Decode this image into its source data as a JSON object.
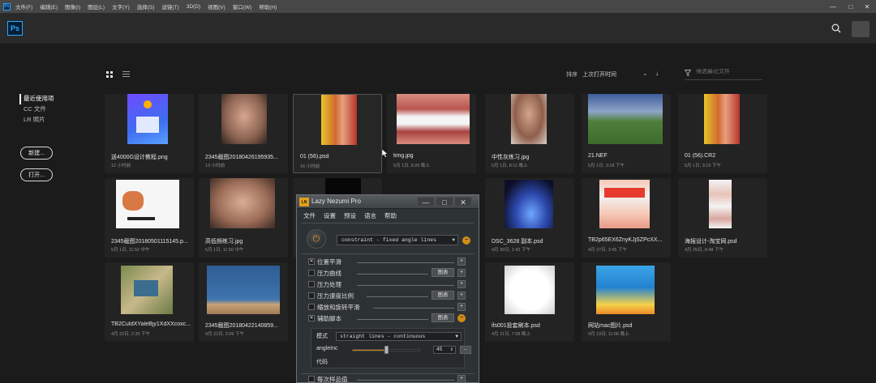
{
  "menubar": {
    "items": [
      "文件(F)",
      "编辑(E)",
      "图像(I)",
      "图层(L)",
      "文字(Y)",
      "选择(S)",
      "滤镜(T)",
      "3D(D)",
      "视图(V)",
      "窗口(W)",
      "帮助(H)"
    ],
    "minimize": "—",
    "maximize": "□",
    "close": "✕"
  },
  "app": {
    "logo": "Ps"
  },
  "leftnav": {
    "items": [
      "最近使用项",
      "CC 文件",
      "LR 照片"
    ],
    "new_button": "新建...",
    "open_button": "打开..."
  },
  "toolbar": {
    "sort_label": "排序",
    "sort_value": "上次打开时间",
    "sort_arrow": "↓",
    "filter_placeholder": "筛选最近文件"
  },
  "files": [
    {
      "name": "送4000G设计教程.png",
      "date": "12 小时前"
    },
    {
      "name": "2345截图20180426195935...",
      "date": "13 小时前"
    },
    {
      "name": "01 (56).psd",
      "date": "16 小时前"
    },
    {
      "name": "timg.jpg",
      "date": "5月 1日, 8:26 晚上"
    },
    {
      "name": "中性灰练习.jpg",
      "date": "5月 1日, 8:11 晚上"
    },
    {
      "name": "21.NEF",
      "date": "5月 1日, 3:18 下午"
    },
    {
      "name": "01 (56).CR2",
      "date": "5月 1日, 3:15 下午"
    },
    {
      "name": "2345截图20180501115145.p...",
      "date": "5月 1日, 11:52 中午"
    },
    {
      "name": "高低频练习.jpg",
      "date": "5月 1日, 11:50 中午"
    },
    {
      "name": "DSC_3628 副本.psd",
      "date": "4月 30日, 1:42 下午"
    },
    {
      "name": "TB2p65EX6ZnyKJjSZPcXX...",
      "date": "4月 27日, 3:45 下午"
    },
    {
      "name": "海报设计-淘宝网.psd",
      "date": "4月 25日, 8:48 下午"
    },
    {
      "name": "TB2CuIdXYaIeBjy1XdXXcoxc...",
      "date": "4月 22日, 2:39 下午"
    },
    {
      "name": "2345截图20180422140859...",
      "date": "4月 22日, 2:09 下午"
    },
    {
      "name": "ifs001投套刷本.psd",
      "date": "4月 21日, 7:58 晚上"
    },
    {
      "name": "网站mac图片.psd",
      "date": "4月 19日, 11:06 晚上"
    }
  ],
  "plugin": {
    "logo": "LN",
    "title": "Lazy Nezumi Pro",
    "ctl_min": "—",
    "ctl_max": "□",
    "ctl_close": "✕",
    "menu": [
      "文件",
      "设置",
      "预设",
      "语言",
      "帮助"
    ],
    "power_glyph": "⏻",
    "mode": "constraint - fixed angle lines",
    "options": [
      {
        "label": "位置平滑",
        "checked": "✕",
        "btn": "",
        "sq": "+"
      },
      {
        "label": "压力曲线",
        "checked": "",
        "btn": "图表",
        "sq": "+"
      },
      {
        "label": "压力处理",
        "checked": "",
        "btn": "",
        "sq": "+"
      },
      {
        "label": "压力速度比例",
        "checked": "",
        "btn": "图表",
        "sq": "+"
      },
      {
        "label": "缩放和旋转平滑",
        "checked": "",
        "btn": "",
        "sq": "+"
      },
      {
        "label": "辅助脚本",
        "checked": "✕",
        "btn": "图表",
        "sq": "−"
      }
    ],
    "sub": {
      "mode_label": "模式",
      "mode_value": "straight lines - continuous",
      "angle_label": "angleInc",
      "angle_value": "45",
      "angle_fraction": 0.5,
      "code_label": "代码",
      "dots": "..."
    },
    "last_option": {
      "label": "每次样品值",
      "checked": "",
      "sq": "+"
    }
  }
}
